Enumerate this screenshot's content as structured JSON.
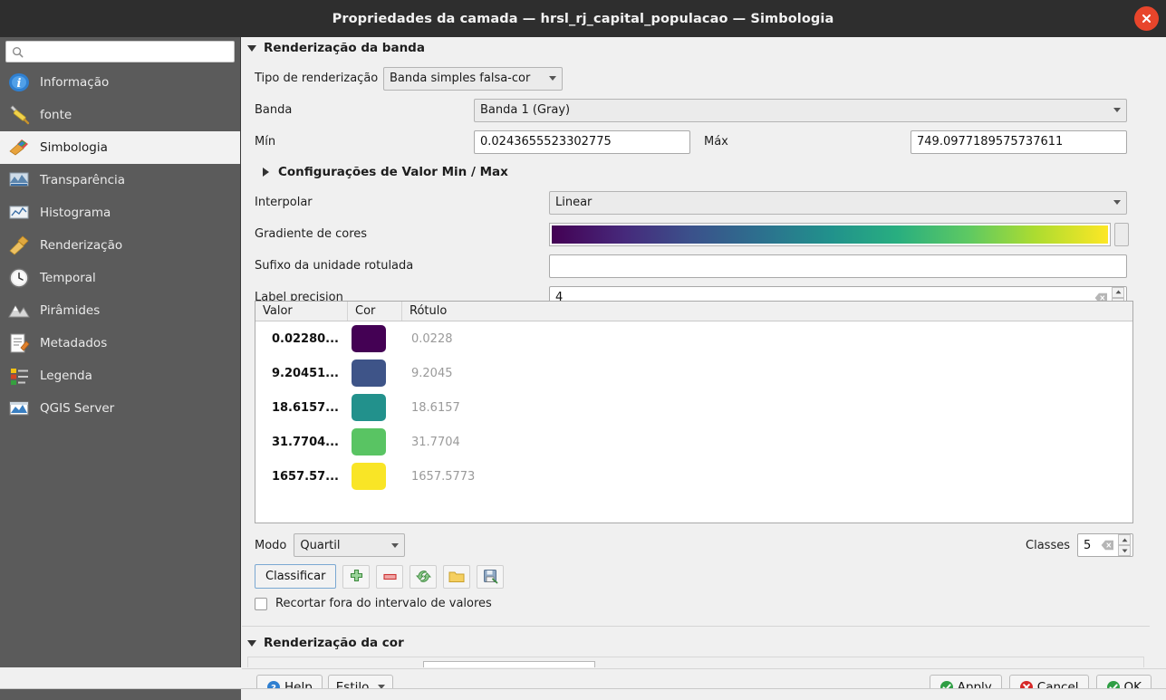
{
  "window": {
    "title": "Propriedades da camada — hrsl_rj_capital_populacao — Simbologia",
    "close_icon": "close-icon"
  },
  "sidebar": {
    "search": {
      "value": "",
      "placeholder": "",
      "icon": "search-icon"
    },
    "items": [
      {
        "label": "Informação",
        "icon": "info-icon",
        "selected": false
      },
      {
        "label": "fonte",
        "icon": "source-wrench-icon",
        "selected": false
      },
      {
        "label": "Simbologia",
        "icon": "symbology-brush-icon",
        "selected": true
      },
      {
        "label": "Transparência",
        "icon": "transparency-icon",
        "selected": false
      },
      {
        "label": "Histograma",
        "icon": "histogram-icon",
        "selected": false
      },
      {
        "label": "Renderização",
        "icon": "rendering-brush-icon",
        "selected": false
      },
      {
        "label": "Temporal",
        "icon": "clock-icon",
        "selected": false
      },
      {
        "label": "Pirâmides",
        "icon": "pyramids-icon",
        "selected": false
      },
      {
        "label": "Metadados",
        "icon": "metadata-icon",
        "selected": false
      },
      {
        "label": "Legenda",
        "icon": "legend-icon",
        "selected": false
      },
      {
        "label": "QGIS Server",
        "icon": "qgis-server-icon",
        "selected": false
      }
    ]
  },
  "band_rendering": {
    "section_title": "Renderização da banda",
    "render_type": {
      "label": "Tipo de renderização",
      "value": "Banda simples falsa-cor"
    },
    "band": {
      "label": "Banda",
      "value": "Banda 1 (Gray)"
    },
    "min": {
      "label": "Mín",
      "value": "0.0243655523302775"
    },
    "max": {
      "label": "Máx",
      "value": "749.0977189575737611"
    },
    "minmax_settings": {
      "label": "Configurações de Valor Min / Max"
    },
    "interpolation": {
      "label": "Interpolar",
      "value": "Linear"
    },
    "color_ramp": {
      "label": "Gradiente de cores",
      "value": "viridis"
    },
    "unit_suffix": {
      "label": "Sufixo da unidade rotulada",
      "value": ""
    },
    "label_precision": {
      "label": "Label precision",
      "value": "4"
    }
  },
  "color_table": {
    "headers": {
      "value": "Valor",
      "color": "Cor",
      "label": "Rótulo"
    },
    "rows": [
      {
        "value": "0.02280...",
        "color": "#440154",
        "label": "0.0228"
      },
      {
        "value": "9.20451...",
        "color": "#3e5488",
        "label": "9.2045"
      },
      {
        "value": "18.6157...",
        "color": "#22918c",
        "label": "18.6157"
      },
      {
        "value": "31.7704...",
        "color": "#59c463",
        "label": "31.7704"
      },
      {
        "value": "1657.57...",
        "color": "#f9e526",
        "label": "1657.5773"
      }
    ]
  },
  "classify": {
    "mode_label": "Modo",
    "mode_value": "Quartil",
    "classes_label": "Classes",
    "classes_value": "5",
    "classify_button": "Classificar",
    "tools": [
      {
        "name": "add-entry-button",
        "icon": "green-plus-icon"
      },
      {
        "name": "remove-entry-button",
        "icon": "red-minus-icon"
      },
      {
        "name": "sort-entries-button",
        "icon": "sort-arrows-icon"
      },
      {
        "name": "load-colormap-button",
        "icon": "folder-icon"
      },
      {
        "name": "save-colormap-button",
        "icon": "floppy-disk-icon"
      }
    ],
    "clip_checkbox": {
      "label": "Recortar fora do intervalo de valores",
      "checked": false
    }
  },
  "color_rendering": {
    "section_title": "Renderização da cor"
  },
  "footer": {
    "help": "Help",
    "style": "Estilo",
    "apply": "Apply",
    "cancel": "Cancel",
    "ok": "OK"
  },
  "colors": {
    "titlebar_bg": "#2e2e2e",
    "sidebar_bg": "#5b5b5b",
    "pane_bg": "#f0f0f0",
    "close_red": "#e8452b",
    "accent_blue": "#7aa8d2"
  }
}
